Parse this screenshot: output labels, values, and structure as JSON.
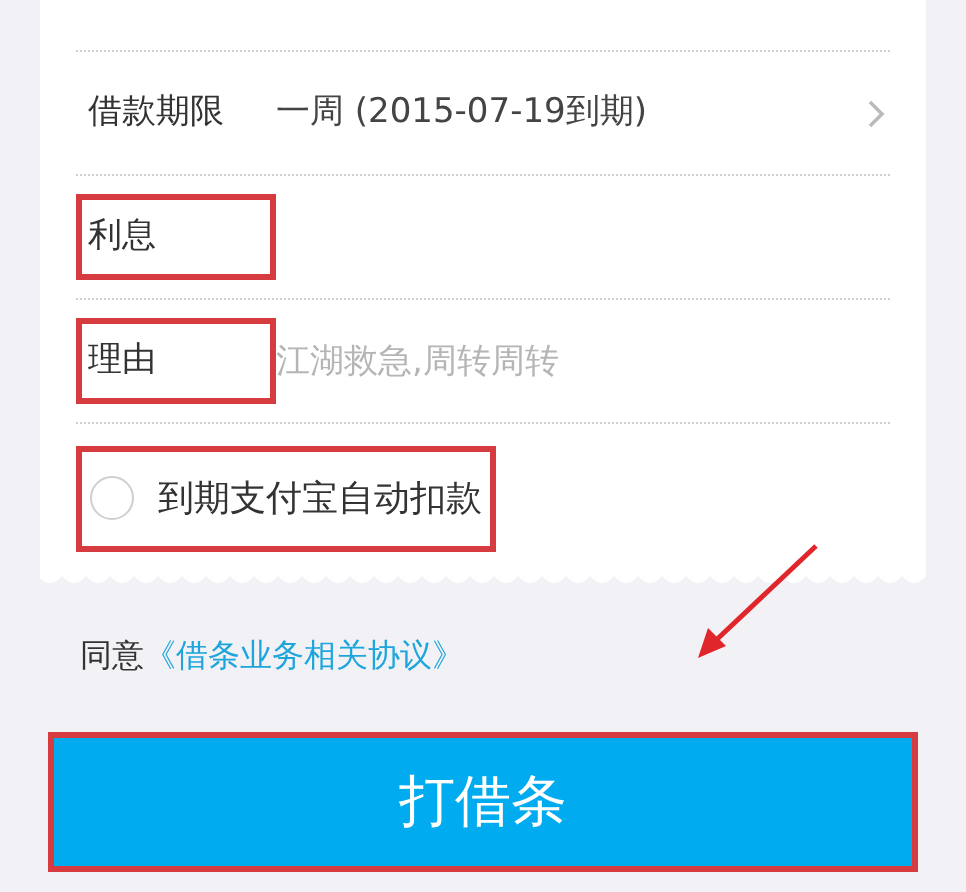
{
  "rows": [
    {
      "kind": "select",
      "label": "借款期限",
      "value": "一周 (2015-07-19到期)",
      "highlighted": false
    },
    {
      "kind": "field",
      "label": "利息",
      "highlighted": true
    },
    {
      "kind": "field",
      "label": "理由",
      "placeholder": "江湖救急,周转周转",
      "highlighted": true
    },
    {
      "kind": "checkbox",
      "label": "到期支付宝自动扣款",
      "checked": false,
      "highlighted": true
    }
  ],
  "agreement": {
    "text": "同意",
    "link": "《借条业务相关协议》"
  },
  "submit": {
    "label": "打借条",
    "highlighted": true
  }
}
